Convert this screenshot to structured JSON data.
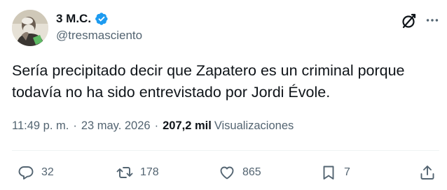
{
  "author": {
    "display_name": "3 M.C.",
    "handle": "@tresmasciento",
    "verified": true
  },
  "tweet": {
    "lines": [
      "Sería precipitado decir que Zapatero es un criminal porque",
      "todavía no ha sido entrevistado por Jordi Évole."
    ]
  },
  "meta": {
    "time": "11:49 p. m.",
    "separator": "·",
    "date": "23 may. 2026",
    "views_count": "207,2 mil",
    "views_label": "Visualizaciones"
  },
  "actions": {
    "replies": "32",
    "reposts": "178",
    "likes": "865",
    "bookmarks": "7"
  },
  "colors": {
    "text": "#0f1419",
    "secondary": "#536471",
    "verified": "#1d9bf0",
    "divider": "#eff3f4"
  },
  "icons": [
    "verified-badge-icon",
    "grok-icon",
    "more-icon",
    "reply-icon",
    "repost-icon",
    "like-icon",
    "bookmark-icon",
    "share-icon"
  ]
}
